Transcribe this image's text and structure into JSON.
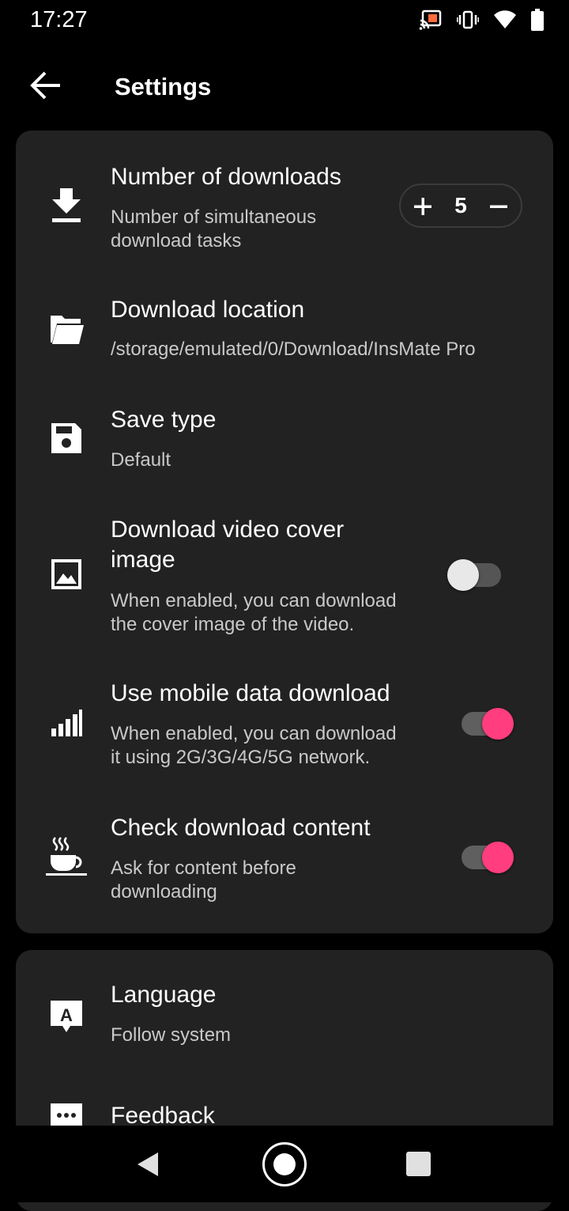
{
  "status_bar": {
    "time": "17:27",
    "icons": [
      "cast-icon",
      "vibrate-icon",
      "wifi-icon",
      "battery-icon"
    ]
  },
  "app_bar": {
    "title": "Settings",
    "back_icon": "arrow-back-icon"
  },
  "download_settings": {
    "number_of_downloads": {
      "title": "Number of downloads",
      "subtitle_line1": "Number of simultaneous",
      "subtitle_line2": "download tasks",
      "value": "5",
      "icon": "download-icon"
    },
    "download_location": {
      "title": "Download location",
      "subtitle": "/storage/emulated/0/Download/InsMate Pro",
      "icon": "folder-icon"
    },
    "save_type": {
      "title": "Save type",
      "subtitle": "Default",
      "icon": "save-icon"
    },
    "video_cover": {
      "title_line1": "Download video cover",
      "title_line2": "image",
      "subtitle_line1": "When enabled, you can download",
      "subtitle_line2": "the cover image of the video.",
      "enabled": false,
      "icon": "image-icon"
    },
    "mobile_data": {
      "title": "Use mobile data download",
      "subtitle_line1": "When enabled, you can download",
      "subtitle_line2": "it using 2G/3G/4G/5G network.",
      "enabled": true,
      "icon": "signal-bars-icon"
    },
    "check_content": {
      "title": "Check download content",
      "subtitle_line1": "Ask for content before",
      "subtitle_line2": "downloading",
      "enabled": true,
      "icon": "coffee-cup-icon"
    }
  },
  "general_settings": {
    "language": {
      "title": "Language",
      "subtitle": "Follow system",
      "icon": "language-icon"
    },
    "feedback": {
      "title": "Feedback",
      "icon": "feedback-icon"
    }
  },
  "colors": {
    "accent": "#ff3d7f",
    "card": "#222222",
    "background": "#000000"
  },
  "nav_bar": {
    "icons": [
      "nav-back-icon",
      "nav-home-icon",
      "nav-recents-icon"
    ]
  }
}
